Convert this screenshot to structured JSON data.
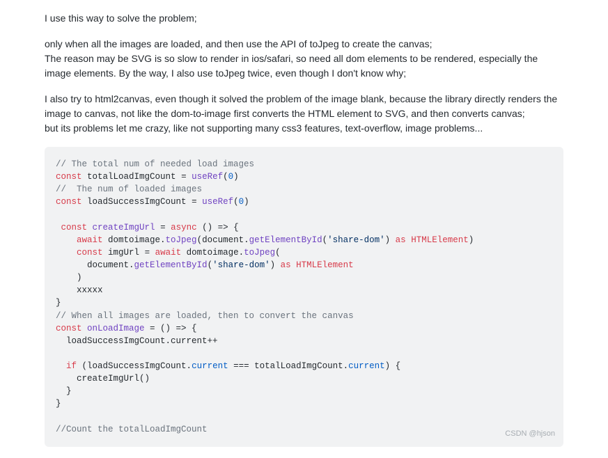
{
  "paragraphs": {
    "p1": "I use this way to solve the problem;",
    "p2_l1": "only when all the images are loaded, and then use the API of toJpeg to create the canvas;",
    "p2_l2": "The reason may be SVG is so slow to render in ios/safari, so need all dom elements to be rendered, especially the image elements. By the way, I also use toJpeg twice, even though I don't know why;",
    "p3_l1": "I also try to html2canvas, even though it solved the problem of the image blank, because the library directly renders the image to canvas, not like the dom-to-image first converts the HTML element to SVG, and then converts canvas;",
    "p3_l2": "but its problems let me crazy, like not supporting many css3 features, text-overflow, image problems..."
  },
  "code": {
    "c1": "// The total num of needed load images",
    "kw_const": "const",
    "ident_totalLoadImgCount": "totalLoadImgCount",
    "eq": " = ",
    "fn_useRef": "useRef",
    "lparen": "(",
    "num_0": "0",
    "rparen": ")",
    "c2": "//  The num of loaded images",
    "ident_loadSuccessImgCount": "loadSuccessImgCount",
    "ident_createImgUrl": "createImgUrl",
    "kw_async": "async",
    "arrow_open": " () => {",
    "kw_await": "await",
    "ident_domtoimage": " domtoimage.",
    "fn_toJpeg": "toJpeg",
    "ident_document": "document.",
    "fn_getElementById": "getElementById",
    "str_sharedom": "'share-dom'",
    "rparen_sp": ") ",
    "kw_as": "as",
    "type_HTMLElement": " HTMLElement",
    "ident_imgUrl": "imgUrl",
    "ident_xxxxx": "xxxxx",
    "rbrace": "}",
    "c3": "// When all images are loaded, then to convert the canvas",
    "ident_onLoadImage": "onLoadImage",
    "arrow_open2": " = () => {",
    "line_loadpp": "  loadSuccessImgCount.current++",
    "kw_if": "if",
    "if_open": " (loadSuccessImgCount.",
    "ident_current": "current",
    "op_eqeq": " === ",
    "if_mid": "totalLoadImgCount.",
    "if_close": ") {",
    "call_createImgUrl": "    createImgUrl()",
    "rbrace_indent": "  }",
    "c4": "//Count the totalLoadImgCount"
  },
  "watermark": "CSDN @hjson"
}
